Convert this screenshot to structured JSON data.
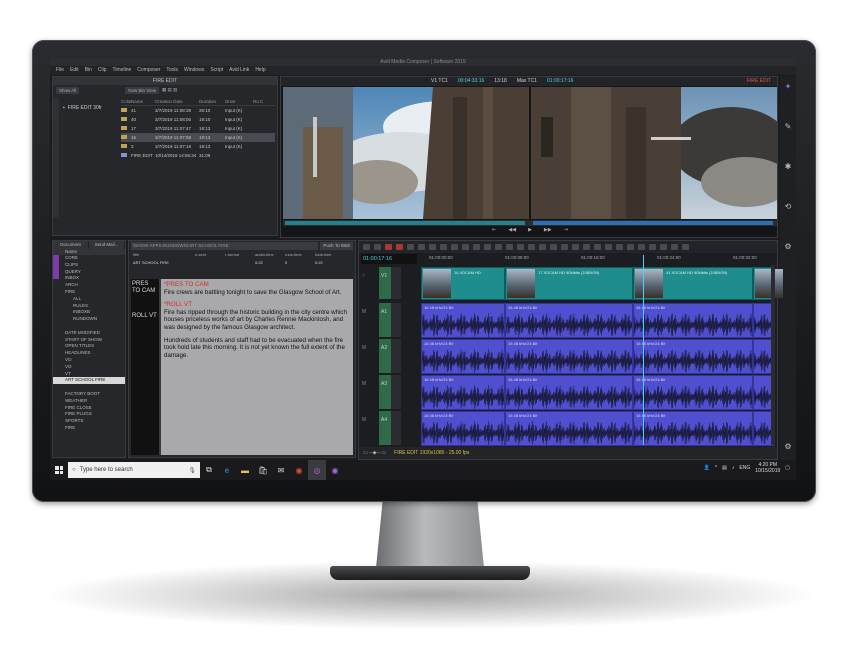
{
  "window": {
    "title": "Avid Media Composer | Software 2019"
  },
  "menu": [
    "File",
    "Edit",
    "Bin",
    "Clip",
    "Timeline",
    "Composer",
    "Tools",
    "Windows",
    "Script",
    "Avid Link",
    "Help"
  ],
  "bin": {
    "title": "FIRE EDIT",
    "show_all": "Show All",
    "view": "Now Bin View",
    "project_item": "FIRE EDIT 30fr",
    "columns": [
      "Color",
      "Name",
      "Creation Date",
      "Duration",
      "Drive",
      "Ro C"
    ],
    "rows": [
      {
        "name": "41",
        "date": "3/7/2019 11:08:38",
        "duration": "28:10",
        "drive": "Input (K)",
        "type": "clip"
      },
      {
        "name": "40",
        "date": "3/7/2019 11:08:05",
        "duration": "19:10",
        "drive": "Input (K)",
        "type": "clip"
      },
      {
        "name": "17",
        "date": "3/7/2019 11:07:47",
        "duration": "19:13",
        "drive": "Input (K)",
        "type": "clip"
      },
      {
        "name": "16",
        "date": "3/7/2019 11:07:58",
        "duration": "19:13",
        "drive": "Input (K)",
        "type": "clip",
        "selected": true
      },
      {
        "name": "3",
        "date": "3/7/2019 11:07:18",
        "duration": "19:13",
        "drive": "Input (K)",
        "type": "clip"
      },
      {
        "name": "FIRE EDIT",
        "date": "10/14/2019 14:56:34",
        "duration": "31:09",
        "drive": "",
        "type": "sequence"
      }
    ]
  },
  "viewer": {
    "source_label": "V1 TC1",
    "source_tc": "00:04:33:16",
    "mid": "13:18",
    "mas_label": "Mas TC1",
    "record_tc": "01:00:17:16",
    "sequence": "FIRE EDIT"
  },
  "browser": {
    "tabs": [
      "Document",
      "Send Mail..."
    ],
    "sort_label": "Name",
    "items": [
      "CORE",
      "CLIPS",
      "QUERY",
      "INBOX",
      "ARCH",
      "FIRE",
      "ALL",
      "RULES",
      "INBOXB",
      "RUNDOWN",
      "",
      "DATE MODIFIED",
      "START OF SHOW",
      "OPEN TITLES",
      "HEADLINES",
      "VO",
      "VO",
      "VT",
      "ART SCHOOL FIRE",
      "",
      "FACTORY BOOT",
      "WEATHER",
      "FIRE CLOSE",
      "FIRE PLUGS",
      "SPORTS",
      "FIRE"
    ],
    "selected_index": 18
  },
  "script": {
    "path": "\\SHOW-APPS.RUNDOWN\\ART SCHOOL FIRE",
    "button": "Push To Web",
    "meta_headers": [
      "title",
      "e-sent",
      "r-format",
      "audio-time",
      "runs-time",
      "total-time"
    ],
    "meta_values": [
      "ART SCHOOL FIRE",
      "",
      "",
      "0:22",
      "0",
      "0:22"
    ],
    "cues": [
      "PRES TO CAM",
      "ROLL VT"
    ],
    "cue1_heading": "*PRES TO CAM",
    "para1": "Fire crews are battling tonight to save the Glasgow School of Art.",
    "cue2_heading": "*ROLL VT",
    "para2": "Fire has ripped through the historic building in the city centre which houses priceless works of art by Charles Rennie Mackintosh, and was designed by the famous Glasgow architect.",
    "para3": "Hundreds of students and staff had to be evacuated when the fire took hold late this morning. It is not yet known the full extent of the damage."
  },
  "timeline": {
    "timecode": "01:00:17:16",
    "ruler": [
      "01:00:00:00",
      "01:00:08:00",
      "01:00:16:00",
      "01:00:24:00",
      "01:00:32:00"
    ],
    "tracks": [
      "V1",
      "A1",
      "A2",
      "A3",
      "A4"
    ],
    "video_clips": [
      {
        "label": "16 XDCAM HD"
      },
      {
        "label": "17 XDCAM HD 50Mbits (1080i/59)"
      },
      {
        "label": "41 XDCAM HD 50Mbits (1080i/59)"
      }
    ],
    "audio_label": "16 48 kHz/24 Bit",
    "status": "FIRE EDIT  1920x1080 - 25.00 fps"
  },
  "taskbar": {
    "search_placeholder": "Type here to search",
    "lang": "ENG",
    "time": "4:20 PM",
    "date": "10/15/2019"
  }
}
